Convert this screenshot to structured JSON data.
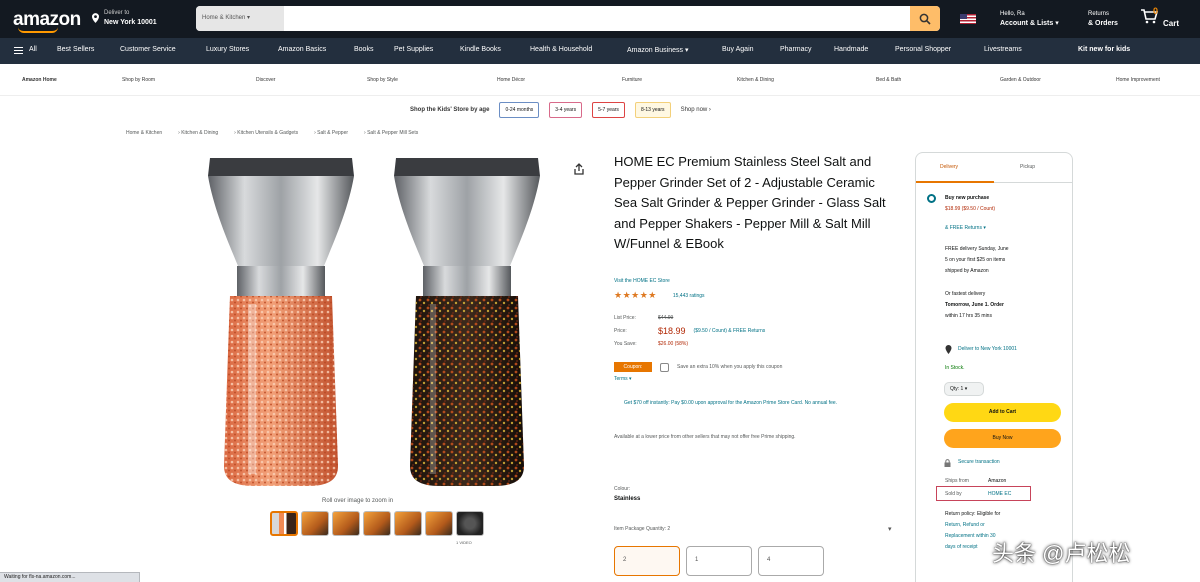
{
  "nav": {
    "logo": "amazon",
    "deliver_line1": "Deliver to",
    "deliver_line2": "New York 10001",
    "search_category": "Home & Kitchen ▾",
    "search_placeholder": "",
    "account_line1": "Hello, Ra",
    "account_line2": "Account & Lists ▾",
    "orders_line1": "Returns",
    "orders_line2": "& Orders",
    "cart_count": "0",
    "cart_label": "Cart"
  },
  "subnav": {
    "all": "All",
    "items": [
      "Best Sellers",
      "Customer Service",
      "Luxury Stores",
      "Amazon Basics",
      "Books",
      "Pet Supplies",
      "Kindle Books",
      "Health & Household",
      "Amazon Business ▾",
      "Buy Again",
      "Pharmacy",
      "Handmade",
      "Personal Shopper",
      "Livestreams"
    ],
    "promo": "Kit new for kids"
  },
  "categories": [
    "Amazon Home",
    "Shop by Room",
    "Discover",
    "Shop by Style",
    "Home Décor",
    "Furniture",
    "Kitchen & Dining",
    "Bed & Bath",
    "Garden & Outdoor",
    "Home Improvement"
  ],
  "age_shop": {
    "label": "Shop the Kids' Store by age",
    "options": [
      "0-24 months",
      "3-4 years",
      "5-7 years",
      "8-13 years"
    ],
    "more": "Shop now ›"
  },
  "breadcrumb": [
    "Home & Kitchen",
    "Kitchen & Dining",
    "Kitchen Utensils & Gadgets",
    "Salt & Pepper",
    "Salt & Pepper Mill Sets"
  ],
  "image": {
    "caption": "Roll over image to zoom in",
    "video_label": "1 VIDEO"
  },
  "product": {
    "title": "HOME EC Premium Stainless Steel Salt and Pepper Grinder Set of 2 - Adjustable Ceramic Sea Salt Grinder & Pepper Grinder - Glass Salt and Pepper Shakers - Pepper Mill & Salt Mill W/Funnel & EBook",
    "store": "Visit the HOME EC Store",
    "stars": "★★★★★",
    "rating_value": 4.5,
    "ratings_count": "15,443 ratings",
    "list_price_label": "List Price:",
    "list_price": "$44.99",
    "price_label": "Price:",
    "price": "$18.99",
    "price_note": "($9.50 / Count) & FREE Returns",
    "save_label": "You Save:",
    "save_value": "$26.00 (58%)",
    "coupon_badge": "Coupon:",
    "coupon_text": "Save an extra 10% when you apply this coupon",
    "terms": "Terms ▾",
    "promo": "Get $70 off instantly: Pay $0.00 upon approval for the Amazon Prime Store Card. No annual fee.",
    "availability_note": "Available at a lower price from other sellers that may not offer free Prime shipping.",
    "colour_label": "Colour:",
    "colour_value": "Stainless",
    "quantity_label": "Item Package Quantity: 2",
    "quantity_options": [
      "2",
      "1",
      "4"
    ]
  },
  "buybox": {
    "tab_1": "Delivery",
    "tab_2": "Pickup",
    "option": "Buy new purchase",
    "option_price": "$18.99 ($9.50 / Count)",
    "free_returns": "& FREE Returns ▾",
    "delivery_1": "FREE delivery Sunday, June",
    "delivery_2": "5 on your first $25 on items",
    "delivery_3": "shipped by Amazon",
    "fastest_1": "Or fastest delivery",
    "fastest_2": "Tomorrow, June 1. Order",
    "fastest_3": "within 17 hrs 35 mins",
    "location": "Deliver to New York 10001",
    "stock": "In Stock.",
    "qty": "Qty: 1 ▾",
    "add_to_cart": "Add to Cart",
    "buy_now": "Buy Now",
    "secure": "Secure transaction",
    "ships_label": "Ships from",
    "ships_value": "Amazon",
    "sold_label": "Sold by",
    "sold_value": "HOME EC",
    "return_1": "Return policy: Eligible for",
    "return_2": "Return, Refund or",
    "return_3": "Replacement within 30",
    "return_4": "days of receipt"
  },
  "watermark": "头条 @卢松松",
  "status": "Waiting for fls-na.amazon.com..."
}
